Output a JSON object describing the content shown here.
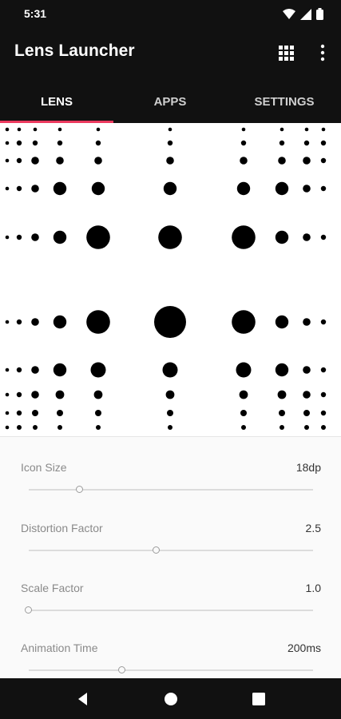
{
  "status_bar": {
    "time": "5:31",
    "icons": [
      "wifi-icon",
      "signal-icon",
      "battery-icon"
    ]
  },
  "app_bar": {
    "title": "Lens Launcher",
    "actions": [
      "apps-grid-icon",
      "more-vert-icon"
    ]
  },
  "tabs": [
    {
      "label": "LENS",
      "selected": true
    },
    {
      "label": "APPS",
      "selected": false
    },
    {
      "label": "SETTINGS",
      "selected": false
    }
  ],
  "colors": {
    "accent": "#ec3a5f",
    "bar": "#111111",
    "dots": "#000000"
  },
  "settings": [
    {
      "label": "Icon Size",
      "value": "18dp",
      "slider_fraction": 0.18
    },
    {
      "label": "Distortion Factor",
      "value": "2.5",
      "slider_fraction": 0.45
    },
    {
      "label": "Scale Factor",
      "value": "1.0",
      "slider_fraction": 0.0
    },
    {
      "label": "Animation Time",
      "value": "200ms",
      "slider_fraction": 0.33
    }
  ],
  "nav_bar": [
    "back-icon",
    "home-icon",
    "recents-icon"
  ]
}
